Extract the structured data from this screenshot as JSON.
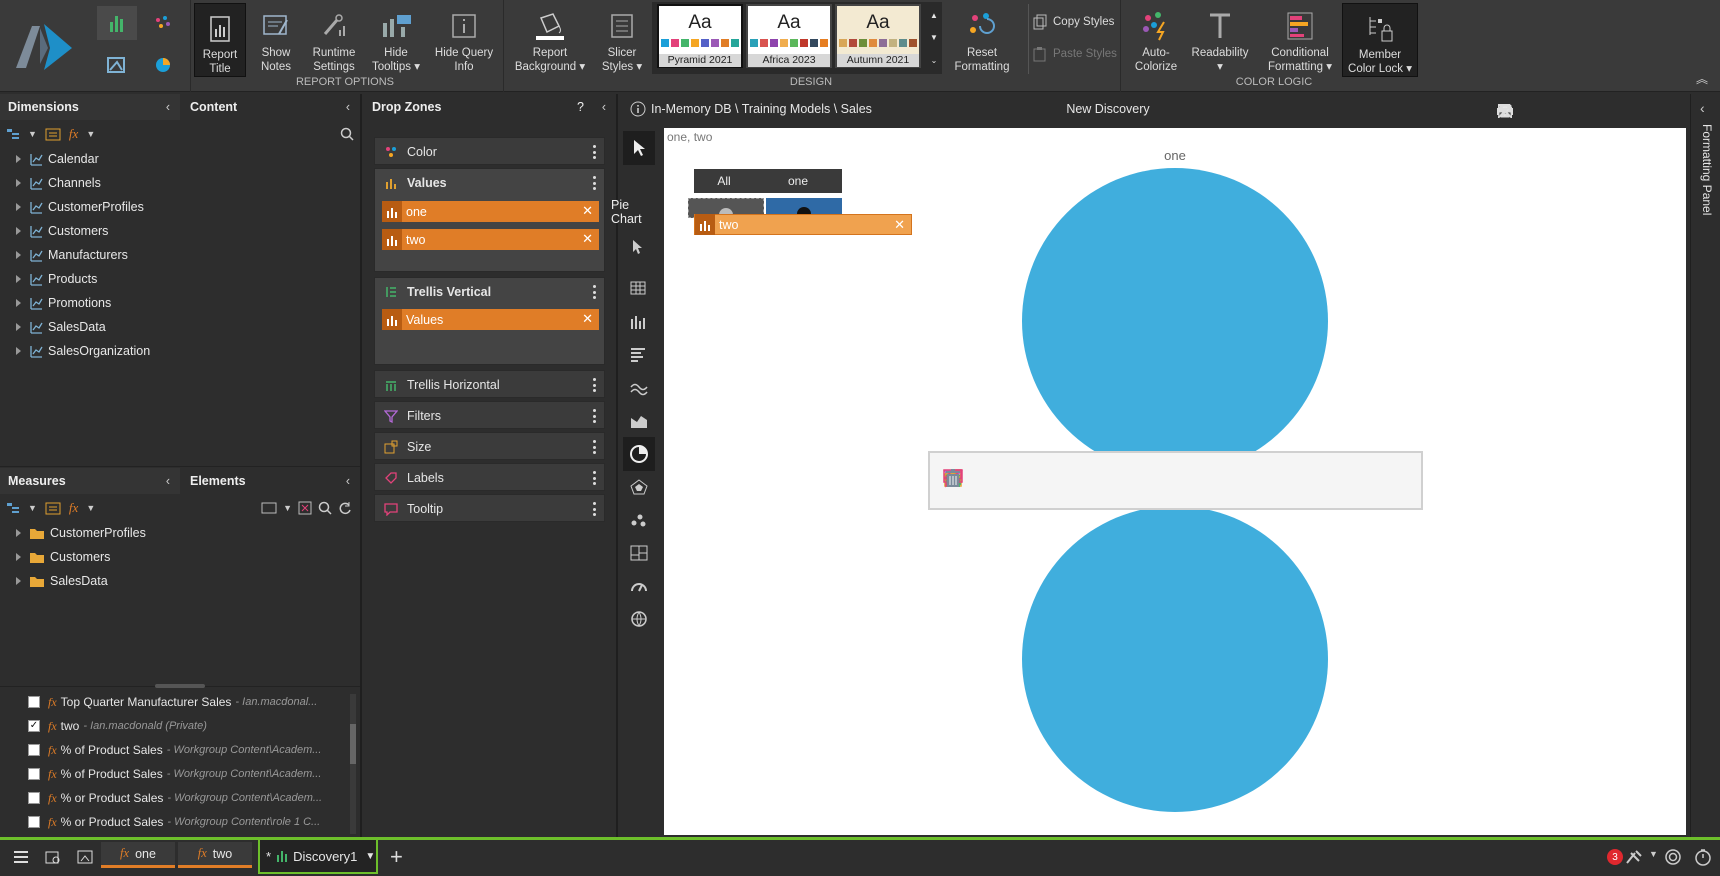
{
  "ribbon": {
    "report_options": {
      "group_label": "REPORT OPTIONS",
      "report_title": "Report\nTitle",
      "show_notes": "Show\nNotes",
      "runtime_settings": "Runtime\nSettings",
      "hide_tooltips": "Hide\nTooltips ▾",
      "hide_query_info": "Hide Query\nInfo"
    },
    "design": {
      "group_label": "DESIGN",
      "report_background": "Report\nBackground ▾",
      "slicer_styles": "Slicer\nStyles ▾",
      "themes": [
        {
          "name": "Pyramid 2021",
          "swatch": [
            "#1b9fd8",
            "#e3427a",
            "#44b56a",
            "#f5a623",
            "#5561c8",
            "#9b59b6",
            "#e07d27",
            "#26a69a"
          ]
        },
        {
          "name": "Africa 2023",
          "swatch": [
            "#2aa1b8",
            "#d9534f",
            "#8e44ad",
            "#f0ad4e",
            "#5cb85c",
            "#c0392b",
            "#34495e",
            "#e67e22"
          ]
        },
        {
          "name": "Autumn 2021",
          "swatch": [
            "#d8a657",
            "#b24a3b",
            "#6d8f3a",
            "#e08b3d",
            "#8d6e97",
            "#c2b280",
            "#5e8c8c",
            "#a0522d"
          ]
        }
      ],
      "reset_formatting": "Reset\nFormatting",
      "copy_styles": "Copy Styles",
      "paste_styles": "Paste Styles"
    },
    "color_logic": {
      "group_label": "COLOR LOGIC",
      "auto_colorize": "Auto-\nColorize",
      "readability": "Readability ▾",
      "conditional_formatting": "Conditional\nFormatting ▾",
      "member_color_lock": "Member\nColor Lock ▾"
    }
  },
  "left_panel": {
    "dimensions_title": "Dimensions",
    "content_title": "Content",
    "dimensions": [
      "Calendar",
      "Channels",
      "CustomerProfiles",
      "Customers",
      "Manufacturers",
      "Products",
      "Promotions",
      "SalesData",
      "SalesOrganization"
    ],
    "measures_title": "Measures",
    "elements_title": "Elements",
    "measures": [
      "CustomerProfiles",
      "Customers",
      "SalesData"
    ],
    "measure_list": [
      {
        "name": "Top Quarter Manufacturer Sales",
        "sub": "- Ian.macdonal...",
        "checked": false
      },
      {
        "name": "two",
        "sub": "- Ian.macdonald (Private)",
        "checked": true
      },
      {
        "name": "% of Product Sales",
        "sub": "- Workgroup Content\\Academ...",
        "checked": false
      },
      {
        "name": "% of Product Sales",
        "sub": "- Workgroup Content\\Academ...",
        "checked": false
      },
      {
        "name": "% or Product Sales",
        "sub": "- Workgroup Content\\Academ...",
        "checked": false
      },
      {
        "name": "% or Product Sales",
        "sub": "- Workgroup Content\\role 1 C...",
        "checked": false
      }
    ],
    "fx": "fx"
  },
  "drop_zones": {
    "title": "Drop Zones",
    "help": "?",
    "color": "Color",
    "values": "Values",
    "value_pills": [
      "one",
      "two"
    ],
    "trellis_vertical": "Trellis Vertical",
    "tv_pills": [
      "Values"
    ],
    "trellis_horizontal": "Trellis Horizontal",
    "filters": "Filters",
    "size": "Size",
    "labels": "Labels",
    "tooltip": "Tooltip"
  },
  "viz": {
    "tooltip_label": "Pie Chart",
    "trellis_header": {
      "all": "All",
      "one": "one"
    },
    "drag_pill": "two"
  },
  "canvas": {
    "breadcrumb": "In-Memory DB \\ Training Models \\ Sales",
    "discovery_title": "New Discovery",
    "subtitle": "one, two",
    "chart_label_top": "one",
    "formatting_panel": "Formatting Panel",
    "pie_color": "#40aedd"
  },
  "chart_data": {
    "type": "pie",
    "title": "",
    "series": [
      {
        "name": "one",
        "values": [
          1
        ]
      },
      {
        "name": "two",
        "values": [
          1
        ]
      }
    ]
  },
  "bottom_bar": {
    "tabs": [
      "one",
      "two"
    ],
    "discovery_tab": "Discovery1",
    "discovery_prefix": "*",
    "badge": "3"
  }
}
